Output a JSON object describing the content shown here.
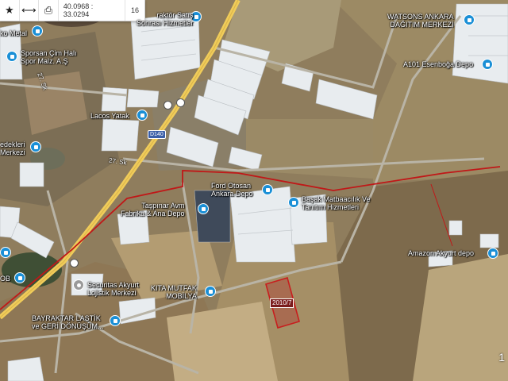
{
  "toolbar": {
    "coordinates": "40.0968 : 33.0294",
    "zoom": "16",
    "icons": [
      "star-icon",
      "measure-icon",
      "print-icon"
    ]
  },
  "places": {
    "metal": "ko Metal",
    "sporsan": "Sporsan Çim Halı\nSpor Malz. A.Ş",
    "lacos": "Lacos Yatak",
    "yedekleri": "edekleri\nMerkezi",
    "traktor": "raktör Satış\nSonrası Hizmetler",
    "watsons": "WATSONS ANKARA\nDAĞITIM MERKEZİ",
    "a101": "A101 Esenboğa Depo",
    "ford": "Ford Otosan\nAnkara Depo",
    "basak": "Başak Matbaacılık Ve\nTanıtım Hizmetleri",
    "taspinar": "Taşpınar Avm\nFabrika & Ana Depo",
    "amazon": "Amazon Akyurt depo",
    "securitas": "Securitas Akyurt\nLojistik Merkezi",
    "kita": "KITA MUTFAK\nMOBİLYA",
    "bayraktar": "BAYRAKTAR LASTİK\nve GERİ DÖNÜŞÜM...",
    "ob": "OB"
  },
  "roads": {
    "sk27_a": "27. Sk",
    "sk27_b": "27. Sk",
    "d140": "D140"
  },
  "parcel": {
    "label": "2010/7"
  },
  "corner": "1",
  "colors": {
    "pin_blue": "#1a8fd6",
    "parcel_outline": "#c81e1e",
    "boundary_red": "#c01818",
    "road_yellow": "#f0cc5a"
  }
}
